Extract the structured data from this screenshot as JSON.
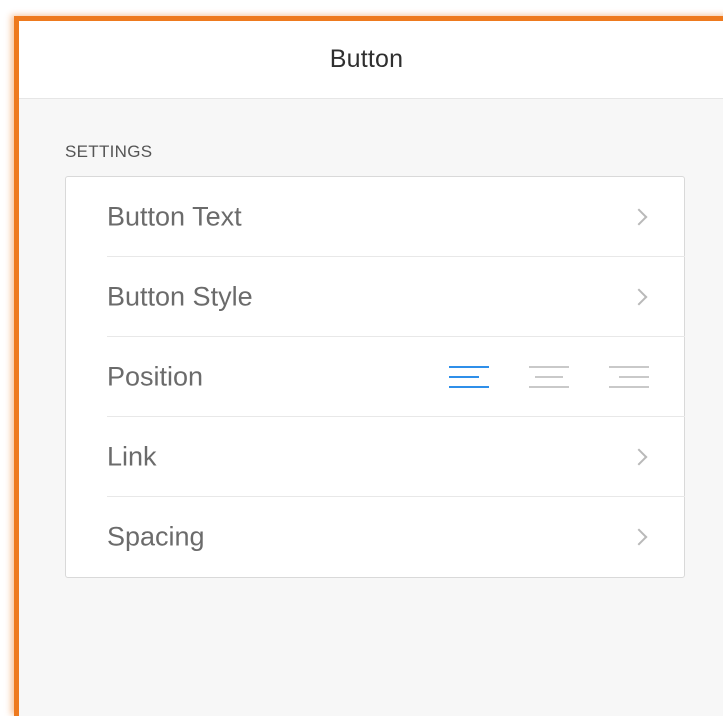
{
  "panel": {
    "title": "Button"
  },
  "settings": {
    "section_label": "SETTINGS",
    "rows": [
      {
        "label": "Button Text",
        "control": "chevron-right-icon"
      },
      {
        "label": "Button Style",
        "control": "chevron-right-icon"
      },
      {
        "label": "Position",
        "control": "alignment-options"
      },
      {
        "label": "Link",
        "control": "chevron-right-icon"
      },
      {
        "label": "Spacing",
        "control": "chevron-right-icon"
      }
    ],
    "position": {
      "options": [
        "align-left-icon",
        "align-center-icon",
        "align-right-icon"
      ],
      "selected": "align-left-icon"
    }
  },
  "colors": {
    "frame_border": "#ee7a1e",
    "accent_active": "#2f8fe9",
    "inactive_icon": "#c9c9c9",
    "panel_background": "#f7f7f7"
  }
}
